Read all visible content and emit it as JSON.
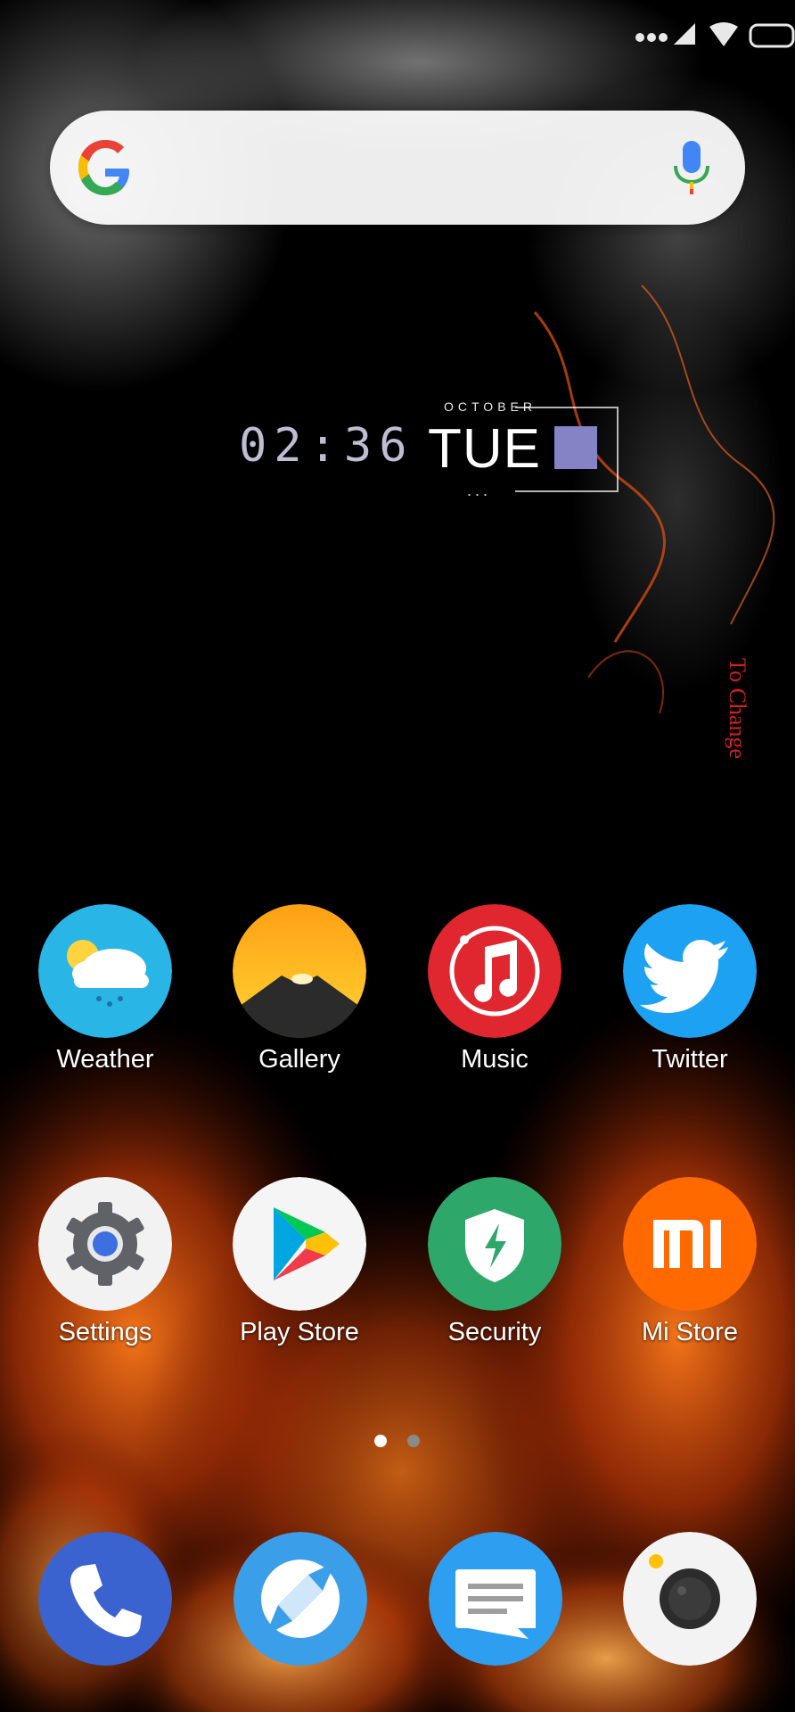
{
  "status_bar": {
    "icons": [
      "more-dots-icon",
      "signal-icon",
      "wifi-icon",
      "battery-icon"
    ]
  },
  "search_bar": {
    "logo": "google-g-icon",
    "action": "microphone-icon"
  },
  "clock_widget": {
    "month": "OCTOBER",
    "time": "02:36",
    "day": "TUE",
    "indicator": "..."
  },
  "side_text": "To Change",
  "apps": [
    {
      "label": "Weather",
      "icon": "weather-icon"
    },
    {
      "label": "Gallery",
      "icon": "gallery-icon"
    },
    {
      "label": "Music",
      "icon": "music-icon"
    },
    {
      "label": "Twitter",
      "icon": "twitter-icon"
    },
    {
      "label": "Settings",
      "icon": "settings-icon"
    },
    {
      "label": "Play Store",
      "icon": "play-store-icon"
    },
    {
      "label": "Security",
      "icon": "security-icon"
    },
    {
      "label": "Mi Store",
      "icon": "mi-store-icon"
    }
  ],
  "page_indicator": {
    "pages": 2,
    "current": 1
  },
  "dock": [
    {
      "icon": "phone-icon"
    },
    {
      "icon": "browser-icon"
    },
    {
      "icon": "messages-icon"
    },
    {
      "icon": "camera-icon"
    }
  ],
  "colors": {
    "weather": "#29b6e6",
    "music": "#e0262f",
    "twitter": "#1da1f2",
    "security": "#2ea86a",
    "mi_store": "#ff6900",
    "phone": "#3a63d0",
    "browser": "#3a9ee8",
    "messages": "#2d9ef0",
    "clock_square": "#8383c6",
    "side_text": "#d12020"
  }
}
